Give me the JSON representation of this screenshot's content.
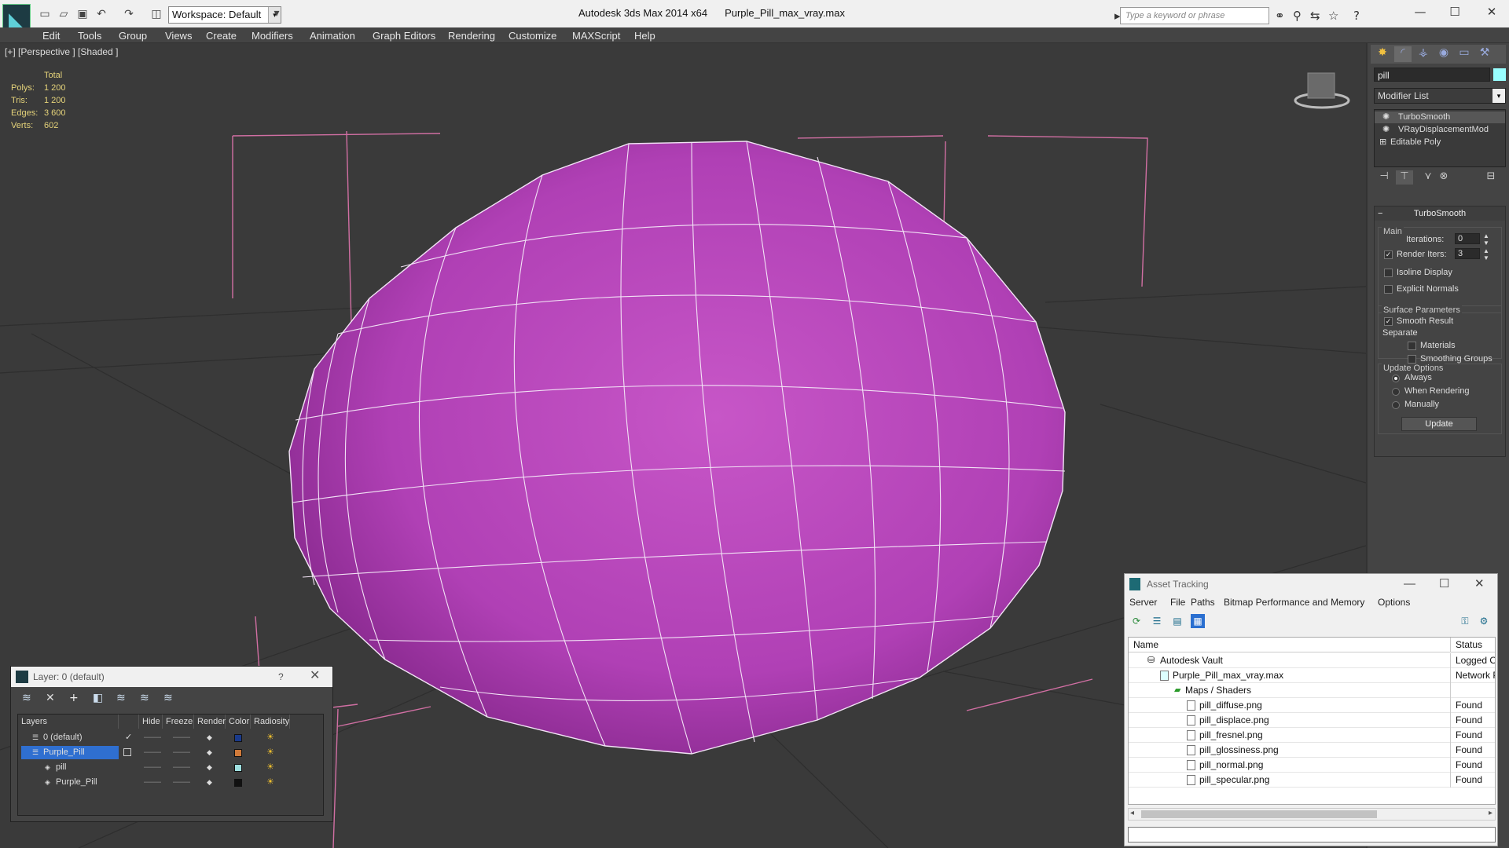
{
  "app": {
    "product": "Autodesk 3ds Max  2014 x64",
    "file": "Purple_Pill_max_vray.max",
    "workspace": "Workspace: Default",
    "search_placeholder": "Type a keyword or phrase"
  },
  "menu": [
    "Edit",
    "Tools",
    "Group",
    "Views",
    "Create",
    "Modifiers",
    "Animation",
    "Graph Editors",
    "Rendering",
    "Customize",
    "MAXScript",
    "Help"
  ],
  "viewport": {
    "label": "[+] [Perspective ] [Shaded ]",
    "stats": {
      "header": "Total",
      "rows": [
        {
          "k": "Polys:",
          "v": "1 200"
        },
        {
          "k": "Tris:",
          "v": "1 200"
        },
        {
          "k": "Edges:",
          "v": "3 600"
        },
        {
          "k": "Verts:",
          "v": "602"
        }
      ]
    }
  },
  "command_panel": {
    "object_name": "pill",
    "object_color": "#99ffff",
    "modifier_list": "Modifier List",
    "stack": [
      "TurboSmooth",
      "VRayDisplacementMod",
      "Editable Poly"
    ],
    "rollout": {
      "title": "TurboSmooth",
      "main_label": "Main",
      "iterations_label": "Iterations:",
      "iterations_value": "0",
      "render_iters_label": "Render Iters:",
      "render_iters_value": "3",
      "isoline": "Isoline Display",
      "explicit": "Explicit Normals",
      "surface_label": "Surface Parameters",
      "smooth_result": "Smooth Result",
      "separate": "Separate",
      "materials": "Materials",
      "smoothing_groups": "Smoothing Groups",
      "update_label": "Update Options",
      "always": "Always",
      "when_rendering": "When Rendering",
      "manually": "Manually",
      "update_button": "Update"
    }
  },
  "layer_dialog": {
    "title": "Layer: 0 (default)",
    "help": "?",
    "columns": [
      "Layers",
      "Hide",
      "Freeze",
      "Render",
      "Color",
      "Radiosity"
    ],
    "rows": [
      {
        "name": "0 (default)",
        "color": "#1a3a8a"
      },
      {
        "name": "Purple_Pill",
        "color": "#d07a3a"
      },
      {
        "name": "pill",
        "color": "#9fe0e0"
      },
      {
        "name": "Purple_Pill",
        "color": "#111111"
      }
    ]
  },
  "asset_tracking": {
    "title": "Asset Tracking",
    "menu": [
      "Server",
      "File",
      "Paths",
      "Bitmap Performance and Memory",
      "Options"
    ],
    "columns": [
      "Name",
      "Status"
    ],
    "rows": [
      {
        "name": "Autodesk Vault",
        "status": "Logged Ou"
      },
      {
        "name": "Purple_Pill_max_vray.max",
        "status": "Network P"
      },
      {
        "name": "Maps / Shaders",
        "status": ""
      },
      {
        "name": "pill_diffuse.png",
        "status": "Found"
      },
      {
        "name": "pill_displace.png",
        "status": "Found"
      },
      {
        "name": "pill_fresnel.png",
        "status": "Found"
      },
      {
        "name": "pill_glossiness.png",
        "status": "Found"
      },
      {
        "name": "pill_normal.png",
        "status": "Found"
      },
      {
        "name": "pill_specular.png",
        "status": "Found"
      }
    ]
  }
}
